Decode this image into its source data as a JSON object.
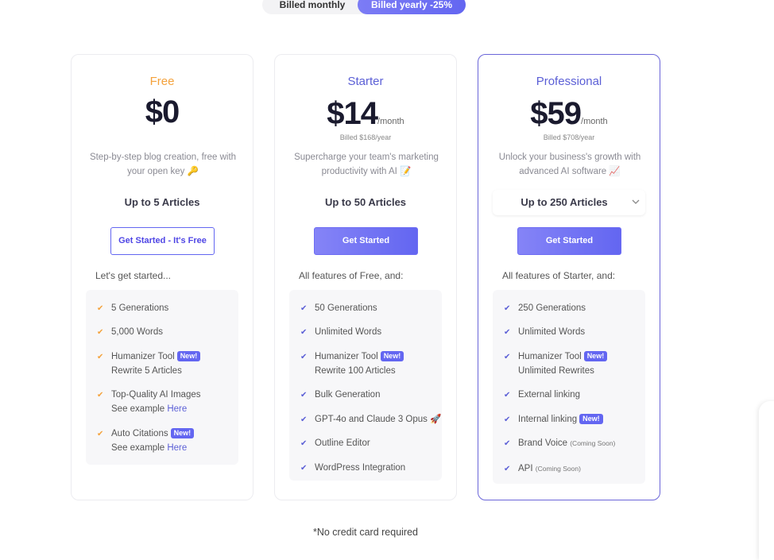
{
  "billing_toggle": {
    "monthly": "Billed monthly",
    "yearly": "Billed yearly -25%",
    "selected": "yearly"
  },
  "colors": {
    "accent": "#6366f1",
    "free_accent": "#f4a23c",
    "check_blue": "#5b5fd6"
  },
  "plans": [
    {
      "name": "Free",
      "name_color": "#f4a23c",
      "price": "$0",
      "per": "",
      "billed": "",
      "description": "Step-by-step blog creation, free with your open key 🔑",
      "articles": "Up to 5 Articles",
      "cta": "Get Started - It's Free",
      "subhead": "Let's get started...",
      "features": [
        {
          "text": "5 Generations"
        },
        {
          "text": "5,000 Words"
        },
        {
          "text": "Humanizer Tool",
          "badge": "New!",
          "sub": "Rewrite 5 Articles"
        },
        {
          "text": "Top-Quality AI Images",
          "sub": "See example",
          "link": "Here"
        },
        {
          "text": "Auto Citations",
          "badge": "New!",
          "sub": "See example",
          "link": "Here"
        }
      ]
    },
    {
      "name": "Starter",
      "name_color": "#5b5fd6",
      "price": "$14",
      "per": "/month",
      "billed": "Billed $168/year",
      "description": "Supercharge your team's marketing productivity with AI 📝",
      "articles": "Up to 50 Articles",
      "cta": "Get Started",
      "subhead": "All features of Free, and:",
      "features": [
        {
          "text": "50 Generations"
        },
        {
          "text": "Unlimited Words"
        },
        {
          "text": "Humanizer Tool",
          "badge": "New!",
          "sub": "Rewrite 100 Articles"
        },
        {
          "text": "Bulk Generation"
        },
        {
          "text": "GPT-4o and Claude 3 Opus 🚀"
        },
        {
          "text": "Outline Editor"
        },
        {
          "text": "WordPress Integration"
        }
      ]
    },
    {
      "name": "Professional",
      "name_color": "#5b5fd6",
      "price": "$59",
      "per": "/month",
      "billed": "Billed $708/year",
      "description": "Unlock your business's growth with advanced AI software 📈",
      "articles": "Up to 250 Articles",
      "cta": "Get Started",
      "subhead": "All features of Starter, and:",
      "features": [
        {
          "text": "250 Generations"
        },
        {
          "text": "Unlimited Words"
        },
        {
          "text": "Humanizer Tool",
          "badge": "New!",
          "sub": "Unlimited Rewrites"
        },
        {
          "text": "External linking"
        },
        {
          "text": "Internal linking",
          "badge": "New!"
        },
        {
          "text": "Brand Voice",
          "soon": "(Coming Soon)"
        },
        {
          "text": "API",
          "soon": "(Coming Soon)"
        }
      ]
    }
  ],
  "footnote": "*No credit card required"
}
